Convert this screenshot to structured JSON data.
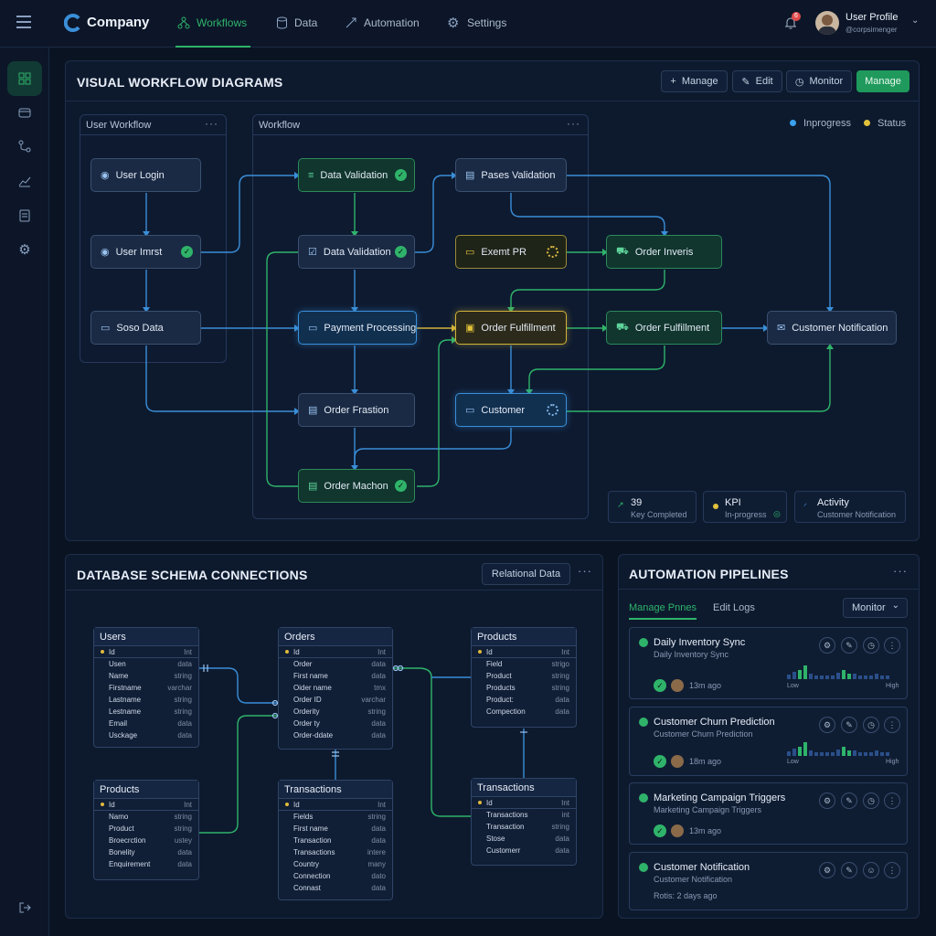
{
  "topbar": {
    "brand": "Company",
    "nav": [
      {
        "label": "Workflows",
        "icon": "workflow-icon",
        "active": true
      },
      {
        "label": "Data",
        "icon": "database-icon"
      },
      {
        "label": "Automation",
        "icon": "automation-icon"
      },
      {
        "label": "Settings",
        "icon": "gear-icon"
      }
    ],
    "notification_count": "6",
    "user_name": "User Profile",
    "user_handle": "@corpsimenger"
  },
  "sidebar": [
    "dashboard-icon",
    "wallet-icon",
    "flow-icon",
    "chart-icon",
    "document-icon",
    "gear-icon",
    "logout-icon"
  ],
  "workflow": {
    "title": "VISUAL WORKFLOW DIAGRAMS",
    "buttons": {
      "manage": "Manage",
      "edit": "Edit",
      "monitor": "Monitor",
      "manage_primary": "Manage"
    },
    "legend": {
      "inprogress": "Inprogress",
      "status": "Status"
    },
    "group_user": "User Workflow",
    "group_workflow": "Workflow",
    "nodes": {
      "user_login": "User Login",
      "user_imrst": "User Imrst",
      "soso_data": "Soso Data",
      "data_validation_1": "Data Validation",
      "data_validation_2": "Data Validation",
      "payment_processing": "Payment Processing",
      "order_fraction": "Order Frastion",
      "order_machon": "Order Machon",
      "pases_validation": "Pases Validation",
      "exemt_pr": "Exemt PR",
      "order_fulfillment_1": "Order Fulfillment",
      "customer": "Customer",
      "order_inveris": "Order Inveris",
      "order_fulfillment_2": "Order Fulfillment",
      "customer_notification": "Customer Notification"
    },
    "kpis": [
      {
        "value": "39",
        "label": "Key Completed"
      },
      {
        "value": "KPI",
        "label": "In-progress"
      },
      {
        "value": "Activity",
        "label": "Customer Notification"
      }
    ]
  },
  "schema": {
    "title": "DATABASE SCHEMA CONNECTIONS",
    "tag": "Relational Data",
    "tables": {
      "users": {
        "name": "Users",
        "rows": [
          [
            "Id",
            "Int"
          ],
          [
            "Usen",
            "data"
          ],
          [
            "Name",
            "string"
          ],
          [
            "Firstname",
            "varchar"
          ],
          [
            "Lastname",
            "string"
          ],
          [
            "Lestname",
            "string"
          ],
          [
            "Email",
            "data"
          ],
          [
            "Usckage",
            "data"
          ]
        ]
      },
      "orders": {
        "name": "Orders",
        "rows": [
          [
            "Id",
            "Int"
          ],
          [
            "Order",
            "data"
          ],
          [
            "First name",
            "data"
          ],
          [
            "Oider name",
            "tmx"
          ],
          [
            "Order ID",
            "varchar"
          ],
          [
            "Orderity",
            "string"
          ],
          [
            "Order ty",
            "data"
          ],
          [
            "Order-ddate",
            "data"
          ]
        ]
      },
      "products_top": {
        "name": "Products",
        "rows": [
          [
            "Id",
            "Int"
          ],
          [
            "Field",
            "strigo"
          ],
          [
            "Product",
            "string"
          ],
          [
            "Products",
            "string"
          ],
          [
            "Product:",
            "data"
          ],
          [
            "Compection",
            "data"
          ]
        ]
      },
      "products_bottom": {
        "name": "Products",
        "rows": [
          [
            "Id",
            "Int"
          ],
          [
            "Namo",
            "string"
          ],
          [
            "Product",
            "string"
          ],
          [
            "Broecrction",
            "ustey"
          ],
          [
            "Bonelity",
            "data"
          ],
          [
            "Enquirement",
            "data"
          ]
        ]
      },
      "transactions_mid": {
        "name": "Transactions",
        "rows": [
          [
            "Id",
            "Int"
          ],
          [
            "Fields",
            "string"
          ],
          [
            "First name",
            "data"
          ],
          [
            "Transaction",
            "data"
          ],
          [
            "Transactions",
            "intere"
          ],
          [
            "Country",
            "many"
          ],
          [
            "Connection",
            "dato"
          ],
          [
            "Connast",
            "data"
          ]
        ]
      },
      "transactions_right": {
        "name": "Transactions",
        "rows": [
          [
            "Id",
            "Int"
          ],
          [
            "Transactions",
            "int"
          ],
          [
            "Transaction",
            "string"
          ],
          [
            "Stose",
            "data"
          ],
          [
            "Customerr",
            "data"
          ]
        ]
      }
    }
  },
  "pipelines": {
    "title": "AUTOMATION PIPELINES",
    "tabs": {
      "manage": "Manage Pnnes",
      "logs": "Edit Logs"
    },
    "monitor": "Monitor",
    "items": [
      {
        "title": "Daily Inventory Sync",
        "subtitle": "Daily Inventory Sync",
        "time": "13m ago",
        "low": "Low",
        "high": "High"
      },
      {
        "title": "Customer Churn Prediction",
        "subtitle": "Customer Churn Prediction",
        "time": "18m ago",
        "low": "Low",
        "high": "High"
      },
      {
        "title": "Marketing Campaign Triggers",
        "subtitle": "Marketing Campaign Triggers",
        "time": "13m ago"
      },
      {
        "title": "Customer Notification",
        "subtitle": "Customer Notification",
        "time": "Rotis: 2 days ago"
      }
    ]
  },
  "colors": {
    "accent_green": "#2fb36a",
    "accent_blue": "#3a8ed8",
    "accent_yellow": "#d0b23a",
    "background": "#0a1322"
  }
}
